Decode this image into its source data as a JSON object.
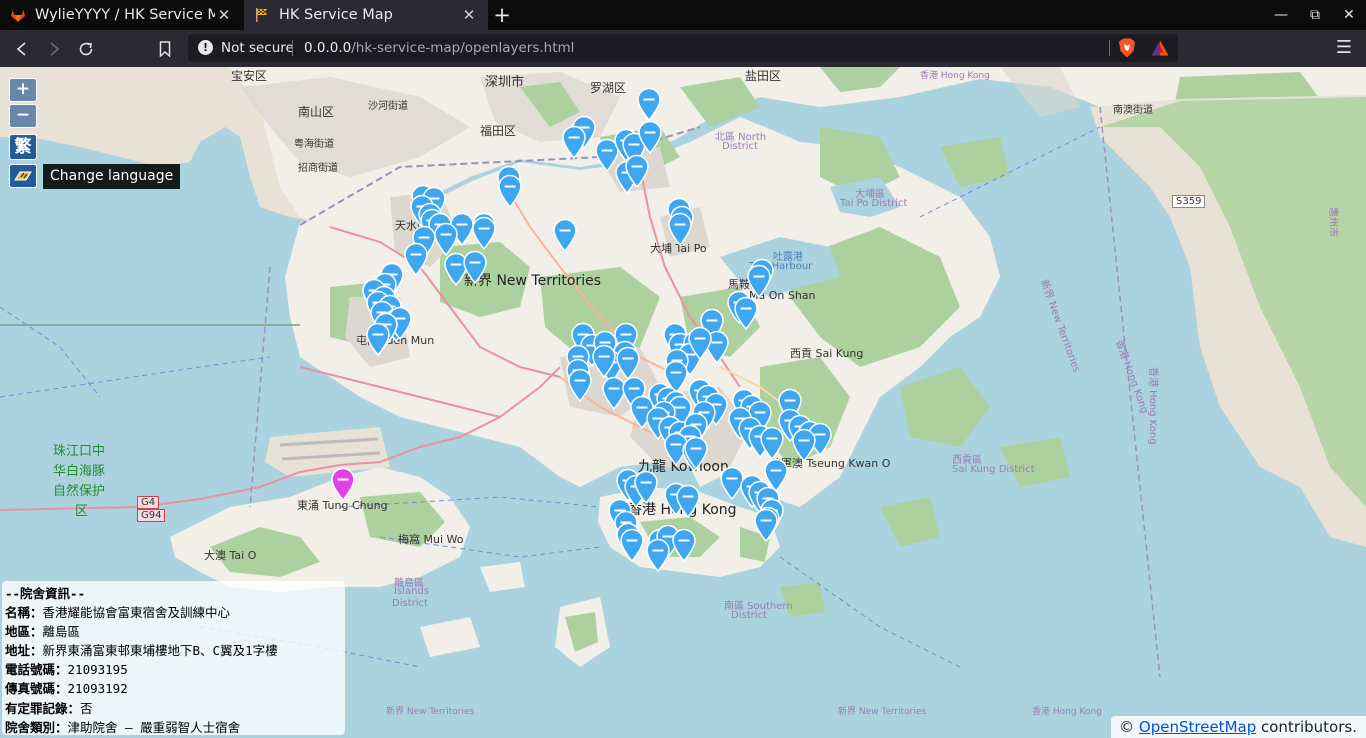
{
  "browser": {
    "tabs": [
      {
        "title": "WylieYYYY / HK Service Map",
        "favicon": "gitlab-icon",
        "active": false
      },
      {
        "title": "HK Service Map",
        "favicon": "flag-icon",
        "active": true
      }
    ],
    "new_tab": "+",
    "window_controls": [
      "minimize-icon",
      "maximize-icon",
      "close-icon"
    ],
    "security_label": "Not secure",
    "url_host": "0.0.0.0",
    "url_path": "/hk-service-map/openlayers.html"
  },
  "map": {
    "zoom_in": "+",
    "zoom_out": "−",
    "language_button": "繁",
    "language_tooltip": "Change language",
    "attribution_prefix": "© ",
    "attribution_link": "OpenStreetMap",
    "attribution_suffix": " contributors.",
    "place_labels": [
      {
        "text": "宝安区"
      },
      {
        "text": "南山区"
      },
      {
        "text": "沙河街道"
      },
      {
        "text": "深圳市"
      },
      {
        "text": "罗湖区"
      },
      {
        "text": "盐田区"
      },
      {
        "text": "福田区"
      },
      {
        "text": "粤海街道"
      },
      {
        "text": "招商街道"
      },
      {
        "text": "南澳街道"
      },
      {
        "text": "香港 Hong Kong"
      },
      {
        "text": "新界 New Territories"
      },
      {
        "text": "大埔 Tai Po"
      },
      {
        "text": "大埔區"
      },
      {
        "text": "Tai Po District"
      },
      {
        "text": "北區 North"
      },
      {
        "text": "District"
      },
      {
        "text": "馬鞍山"
      },
      {
        "text": "Ma On Shan"
      },
      {
        "text": "吐露港"
      },
      {
        "text": "Tolo Harbour"
      },
      {
        "text": "西貢 Sai Kung"
      },
      {
        "text": "西貢區"
      },
      {
        "text": "Sai Kung District"
      },
      {
        "text": "九龍 Kowloon"
      },
      {
        "text": "香港 Hong Kong"
      },
      {
        "text": "將軍澳 Tseung Kwan O"
      },
      {
        "text": "東涌 Tung Chung"
      },
      {
        "text": "梅窩 Mui Wo"
      },
      {
        "text": "大澳 Tai O"
      },
      {
        "text": "離島區"
      },
      {
        "text": "Islands"
      },
      {
        "text": "District"
      },
      {
        "text": "南區 Southern"
      },
      {
        "text": "District"
      },
      {
        "text": "屯門 Tuen Mun"
      },
      {
        "text": "天水圍"
      },
      {
        "text": "珠江口中"
      },
      {
        "text": "华白海豚"
      },
      {
        "text": "自然保护"
      },
      {
        "text": "区"
      },
      {
        "text": "G4"
      },
      {
        "text": "G94"
      },
      {
        "text": "S359"
      },
      {
        "text": "新界 New Territories"
      },
      {
        "text": "新界 New Territories"
      },
      {
        "text": "新界 New Territories"
      },
      {
        "text": "香港 Hong Kong"
      },
      {
        "text": "香港 Hong Kong"
      },
      {
        "text": "香港 Hong Kong"
      },
      {
        "text": "惠州市"
      }
    ],
    "marker_count_note": "",
    "selected_marker_color": "#e040e8",
    "marker_color": "#3ea7f0"
  },
  "info_panel": {
    "header": "--院舍資訊--",
    "fields": [
      {
        "label": "名稱",
        "value": "香港耀能協會富東宿舍及訓練中心"
      },
      {
        "label": "地區",
        "value": "離島區"
      },
      {
        "label": "地址",
        "value": "新界東涌富東邨東埔樓地下B、C翼及1字樓"
      },
      {
        "label": "電話號碼",
        "value": "21093195"
      },
      {
        "label": "傳真號碼",
        "value": "21093192"
      },
      {
        "label": "有定罪記錄",
        "value": "否"
      },
      {
        "label": "院舍類別",
        "value": "津助院舍 – 嚴重弱智人士宿舍"
      }
    ],
    "separator": "："
  }
}
